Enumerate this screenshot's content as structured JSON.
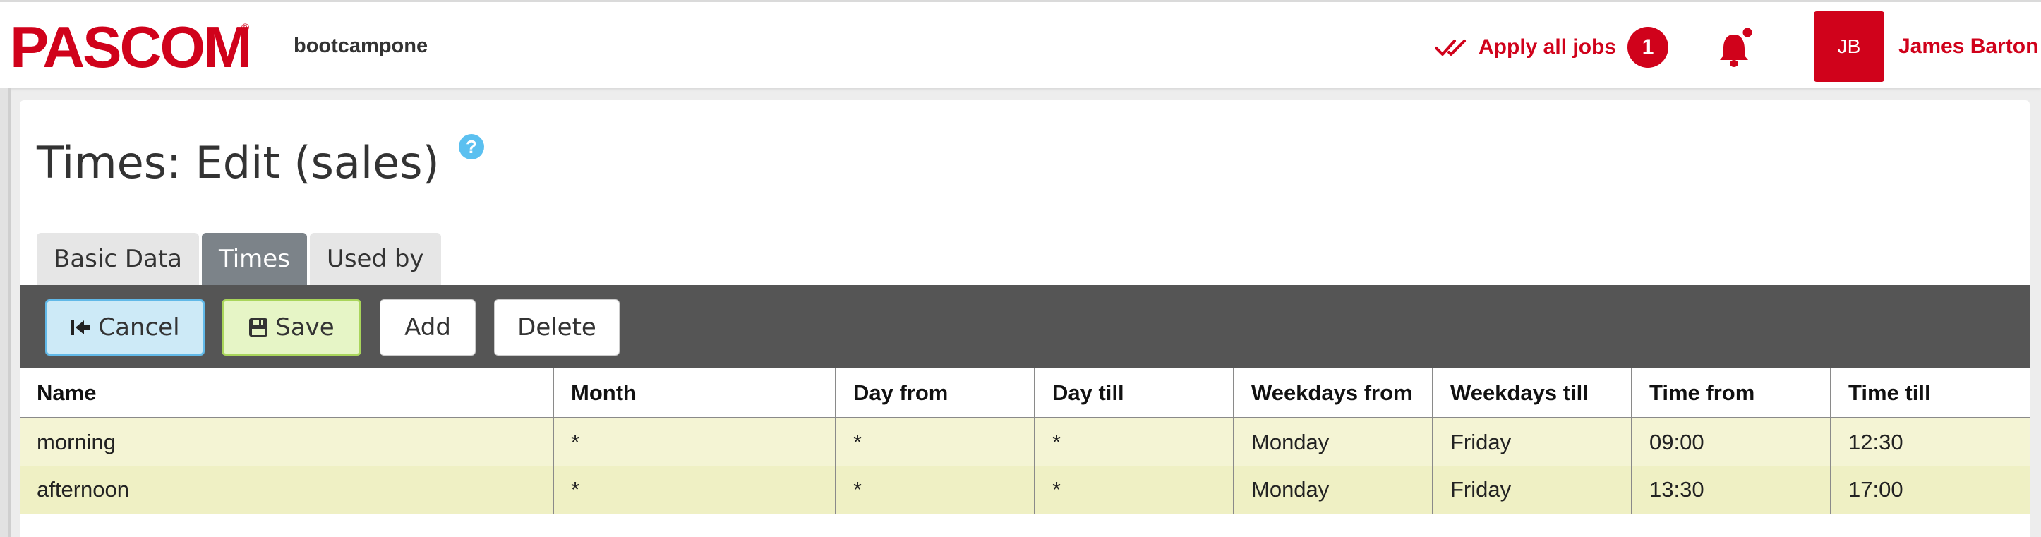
{
  "header": {
    "logo_text": "PASCOM",
    "logo_mark": "®",
    "tenant": "bootcampone",
    "apply_jobs": {
      "label": "Apply all jobs",
      "count": "1",
      "icon": "double-check-icon"
    },
    "notifications": {
      "icon": "bell-icon",
      "has_unread": true
    },
    "user": {
      "initials": "JB",
      "name": "James Barton"
    }
  },
  "page": {
    "title": "Times: Edit (sales)",
    "help_icon": "?"
  },
  "tabs": [
    {
      "label": "Basic Data",
      "active": false
    },
    {
      "label": "Times",
      "active": true
    },
    {
      "label": "Used by",
      "active": false
    }
  ],
  "toolbar": {
    "cancel_label": "Cancel",
    "save_label": "Save",
    "add_label": "Add",
    "delete_label": "Delete"
  },
  "table": {
    "columns": [
      "Name",
      "Month",
      "Day from",
      "Day till",
      "Weekdays from",
      "Weekdays till",
      "Time from",
      "Time till"
    ],
    "rows": [
      [
        "morning",
        "*",
        "*",
        "*",
        "Monday",
        "Friday",
        "09:00",
        "12:30"
      ],
      [
        "afternoon",
        "*",
        "*",
        "*",
        "Monday",
        "Friday",
        "13:30",
        "17:00"
      ]
    ]
  },
  "colors": {
    "brand": "#d0021b",
    "active_tab": "#7c8389",
    "toolbar": "#555555",
    "cancel_bg": "#cdeaf7",
    "save_bg": "#e6f5c6",
    "row_odd": "#f4f4d4",
    "row_even": "#eff0c4"
  }
}
